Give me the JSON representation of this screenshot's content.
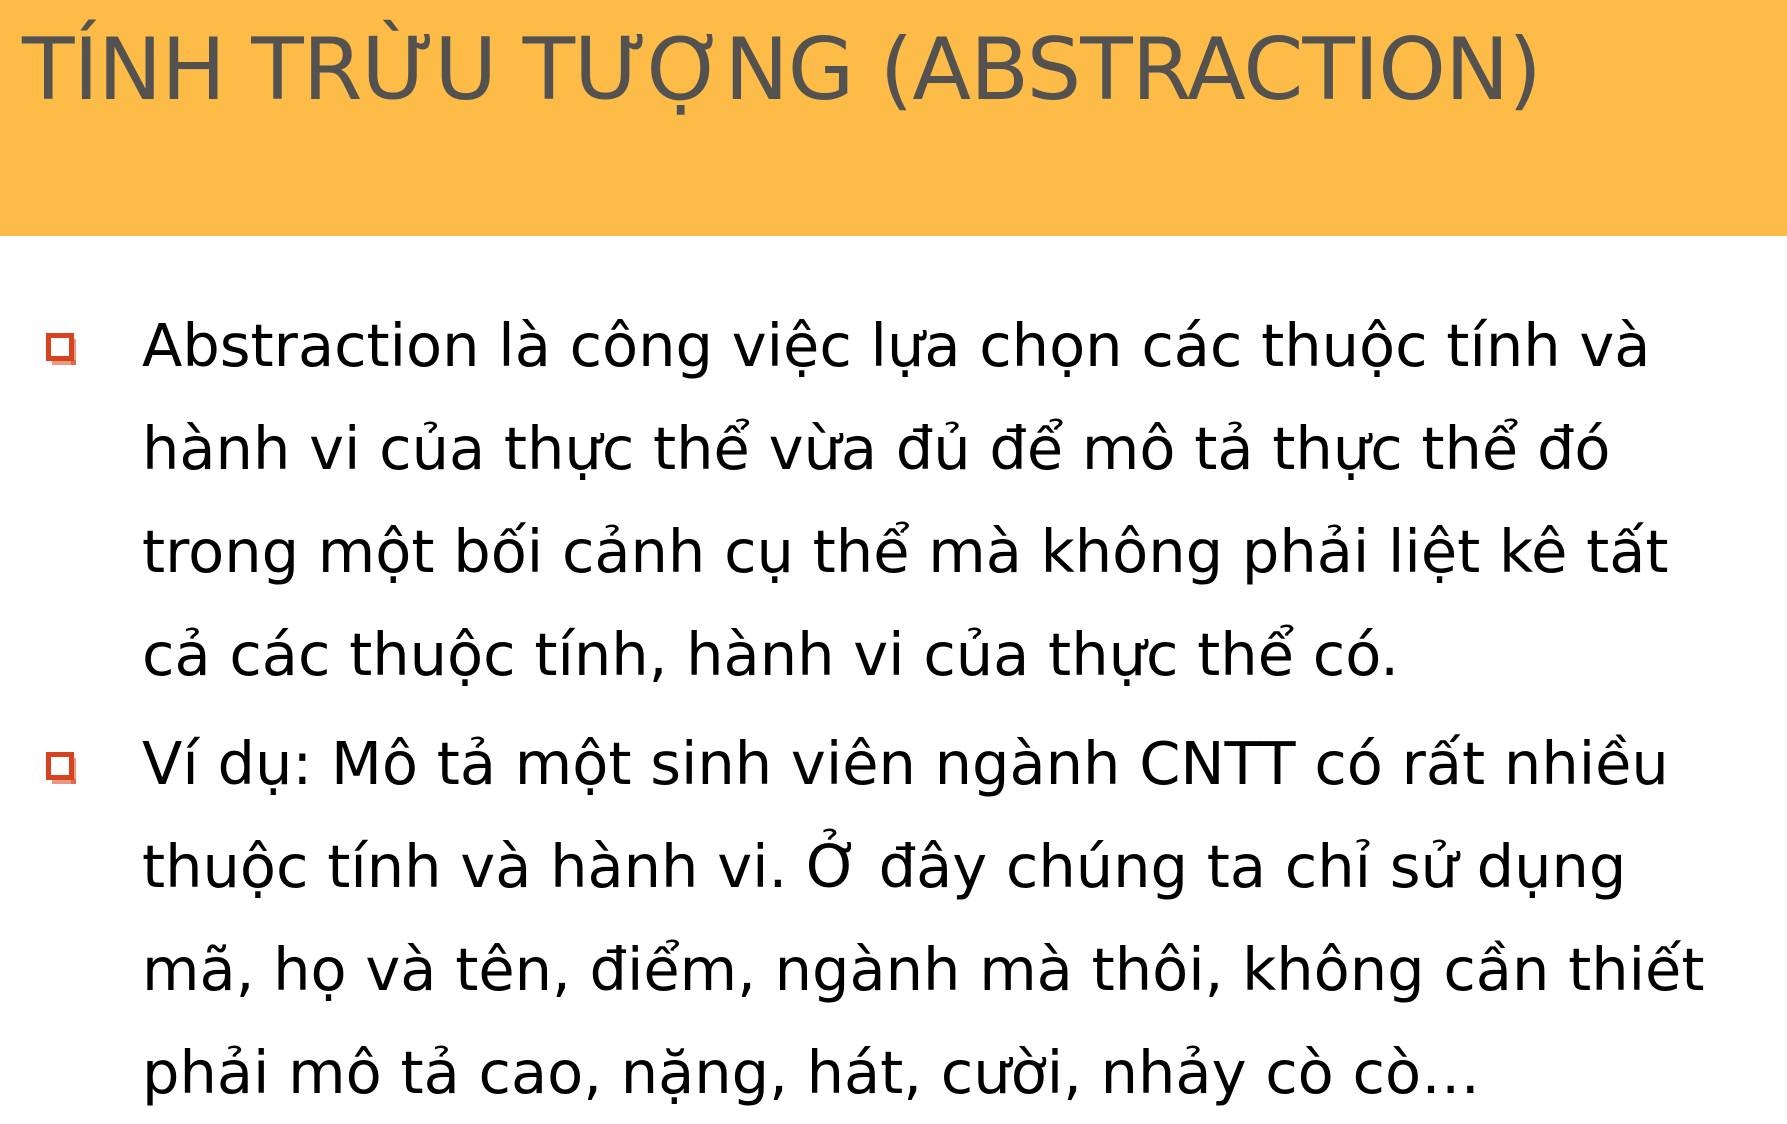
{
  "slide": {
    "title": "TÍNH TRỪU TƯỢNG (ABSTRACTION)",
    "accent_color": "#fdbc48",
    "bullet_color": "#d8431f",
    "bullet_icon": "hollow-square-bullet-icon",
    "bullets": [
      {
        "lines": [
          "Abstraction là công việc lựa chọn các thuộc tính và",
          "hành vi của thực thể vừa đủ để mô tả thực thể đó",
          "trong một bối cảnh cụ thể mà không phải liệt kê tất",
          "cả các thuộc tính, hành vi của thực thể có."
        ]
      },
      {
        "lines": [
          "Ví dụ: Mô tả một sinh viên ngành CNTT có rất nhiều",
          "thuộc tính và hành vi. Ở đây chúng ta chỉ sử dụng",
          "mã, họ và tên, điểm, ngành mà thôi, không cần thiết",
          "phải mô tả cao, nặng, hát, cười, nhảy cò cò…"
        ]
      }
    ]
  }
}
